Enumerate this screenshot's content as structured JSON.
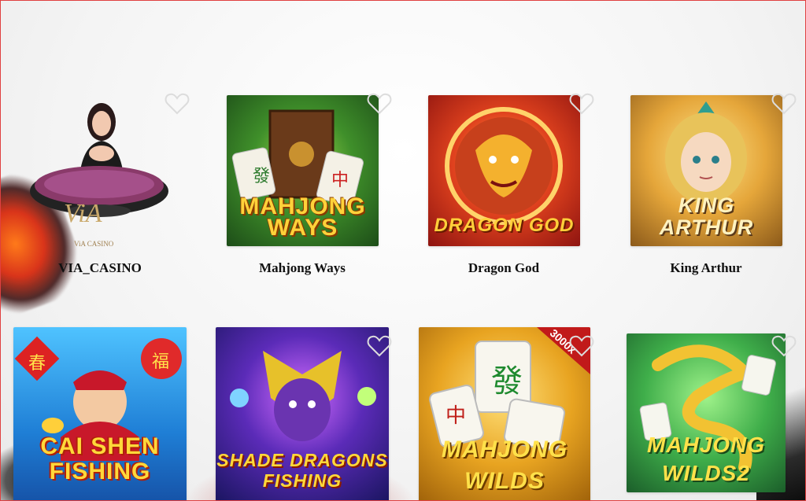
{
  "games": [
    {
      "name": "VIA_CASINO",
      "logo_text": "ViA",
      "logo_sub": "ViA CASINO"
    },
    {
      "name": "Mahjong Ways",
      "art_title": [
        "MAHJONG",
        "WAYS"
      ]
    },
    {
      "name": "Dragon God",
      "art_title": [
        "DRAGON GOD"
      ]
    },
    {
      "name": "King Arthur",
      "art_title": [
        "KING",
        "ARTHUR"
      ]
    },
    {
      "name": "",
      "art_title": [
        "CAI SHEN",
        "FISHING"
      ],
      "art_glyphs": [
        "春",
        "福"
      ]
    },
    {
      "name": "",
      "art_title": [
        "SHADE DRAGONS",
        "FISHING"
      ]
    },
    {
      "name": "",
      "art_title": [
        "MAHJONG",
        "WILDS"
      ],
      "badge": "3000x",
      "tile_glyphs": [
        "發",
        "中"
      ]
    },
    {
      "name": "",
      "art_title": [
        "MAHJONG",
        "WILDS2"
      ]
    }
  ],
  "icons": {
    "favorite": "heart-outline-icon"
  },
  "colors": {
    "border": "#e04040",
    "heart": "#dcdcdc",
    "text": "#111111"
  }
}
